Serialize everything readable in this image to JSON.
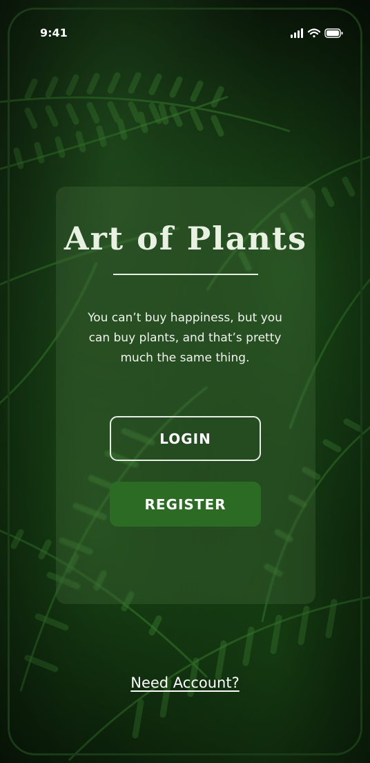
{
  "status_bar": {
    "time": "9:41",
    "icons": [
      "signal-icon",
      "wifi-icon",
      "battery-icon"
    ]
  },
  "hero": {
    "title": "Art of Plants",
    "tagline": "You can’t buy happiness, but you can buy plants, and that’s pretty much the same thing."
  },
  "actions": {
    "login_label": "LOGIN",
    "register_label": "REGISTER"
  },
  "footer": {
    "need_account_label": "Need Account?"
  },
  "colors": {
    "background": "#0f2a0d",
    "card": "#50784647",
    "register_button": "#2b6b24",
    "text": "#ffffff"
  }
}
